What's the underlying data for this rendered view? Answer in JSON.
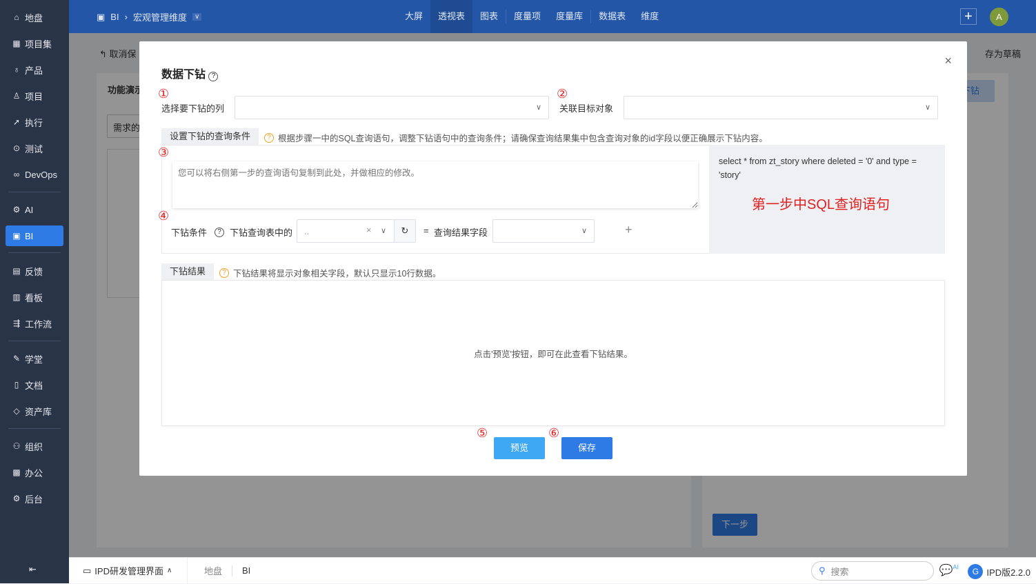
{
  "sidebar": {
    "items": [
      {
        "label": "地盘",
        "icon": "home-icon"
      },
      {
        "label": "项目集",
        "icon": "grid-icon"
      },
      {
        "label": "产品",
        "icon": "lightbulb-icon"
      },
      {
        "label": "项目",
        "icon": "project-icon"
      },
      {
        "label": "执行",
        "icon": "rocket-icon"
      },
      {
        "label": "测试",
        "icon": "test-icon"
      },
      {
        "label": "DevOps",
        "icon": "infinity-icon"
      },
      {
        "label": "AI",
        "icon": "robot-icon"
      },
      {
        "label": "BI",
        "icon": "chart-icon",
        "active": true
      },
      {
        "label": "反馈",
        "icon": "feedback-icon"
      },
      {
        "label": "看板",
        "icon": "kanban-icon"
      },
      {
        "label": "工作流",
        "icon": "workflow-icon"
      },
      {
        "label": "学堂",
        "icon": "school-icon"
      },
      {
        "label": "文档",
        "icon": "doc-icon"
      },
      {
        "label": "资产库",
        "icon": "diamond-icon"
      },
      {
        "label": "组织",
        "icon": "users-icon"
      },
      {
        "label": "办公",
        "icon": "oa-icon"
      },
      {
        "label": "后台",
        "icon": "gear-icon"
      }
    ],
    "collapse_icon": "collapse-icon"
  },
  "topbar": {
    "breadcrumb": [
      "BI",
      "宏观管理维度"
    ],
    "nav": [
      "大屏",
      "透视表",
      "图表",
      "度量项",
      "度量库",
      "数据表",
      "维度"
    ],
    "active_nav": "透视表",
    "avatar": "A"
  },
  "background": {
    "cancel": "取消保",
    "save_draft": "存为草稿",
    "panel_title": "功能演示",
    "field": "需求的",
    "drill_button": "下钻",
    "next_button": "下一步"
  },
  "modal": {
    "title": "数据下钻",
    "step1_label": "选择要下钻的列",
    "step2_label": "关联目标对象",
    "numbers": [
      "①",
      "②",
      "③",
      "④",
      "⑤",
      "⑥"
    ],
    "query_tab": "设置下钻的查询条件",
    "query_hint": "根据步骤一中的SQL查询语句，调整下钻语句中的查询条件；请确保查询结果集中包含查询对象的id字段以便正确展示下钻内容。",
    "textarea_placeholder": "您可以将右侧第一步的查询语句复制到此处，并做相应的修改。",
    "sql": "select * from zt_story where deleted = '0' and type = 'story'",
    "sql_annotation": "第一步中SQL查询语句",
    "cond_label": "下钻条件",
    "cond_table_label": "下钻查询表中的",
    "cond_value": "..",
    "equals": "=",
    "result_field_label": "查询结果字段",
    "result_tab": "下钻结果",
    "result_hint": "下钻结果将显示对象相关字段，默认只显示10行数据。",
    "result_empty": "点击'预览'按钮，即可在此查看下钻结果。",
    "preview": "预览",
    "save": "保存"
  },
  "bottombar": {
    "app": "IPD研发管理界面",
    "crumbs": [
      "地盘",
      "BI"
    ],
    "search_placeholder": "搜索",
    "version": "IPD版2.2.0",
    "ai_badge": "AI"
  },
  "colors": {
    "primary": "#2f7be5",
    "topbar": "#2456a8",
    "sidebar": "#2a3447",
    "annotation": "#e02020"
  }
}
